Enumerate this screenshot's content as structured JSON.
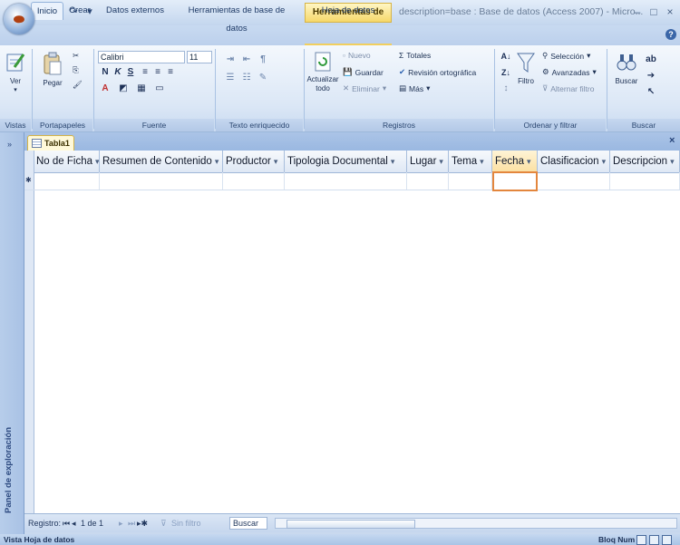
{
  "window": {
    "context_tab": "Herramientas de tabla",
    "title": "description=base : Base de datos (Access 2007) - Micro...",
    "office_button": "⬬",
    "qat": [
      "💾",
      "↶",
      "↷",
      "▾"
    ],
    "controls": [
      "–",
      "□",
      "×"
    ]
  },
  "tabs": [
    "Inicio",
    "Crear",
    "Datos externos",
    "Herramientas de base de datos",
    "Hoja de datos"
  ],
  "ribbon": {
    "vistas": {
      "label": "Vistas",
      "ver": "Ver"
    },
    "portapapeles": {
      "label": "Portapapeles",
      "pegar": "Pegar"
    },
    "fuente": {
      "label": "Fuente",
      "font_name": "Calibri",
      "font_size": "11"
    },
    "texto": {
      "label": "Texto enriquecido"
    },
    "registros": {
      "label": "Registros",
      "actualizar": "Actualizar todo",
      "nuevo": "Nuevo",
      "guardar": "Guardar",
      "eliminar": "Eliminar",
      "totales": "Totales",
      "ortografia": "Revisión ortográfica",
      "mas": "Más"
    },
    "ordenar": {
      "label": "Ordenar y filtrar",
      "filtro": "Filtro",
      "seleccion": "Selección",
      "avanzadas": "Avanzadas",
      "alternar": "Alternar filtro"
    },
    "buscar": {
      "label": "Buscar",
      "buscar_btn": "Buscar"
    }
  },
  "nav_pane": {
    "label": "Panel de exploración"
  },
  "document": {
    "tab": "Tabla1"
  },
  "columns": [
    "No de Ficha",
    "Resumen de Contenido",
    "Productor",
    "Tipologia Documental",
    "Lugar",
    "Tema",
    "Fecha",
    "Clasificacion",
    "Descripcion"
  ],
  "record_nav": {
    "label": "Registro:",
    "position": "1 de 1",
    "filter": "Sin filtro",
    "search": "Buscar"
  },
  "status": {
    "left": "Vista Hoja de datos",
    "right": "Bloq Num"
  }
}
